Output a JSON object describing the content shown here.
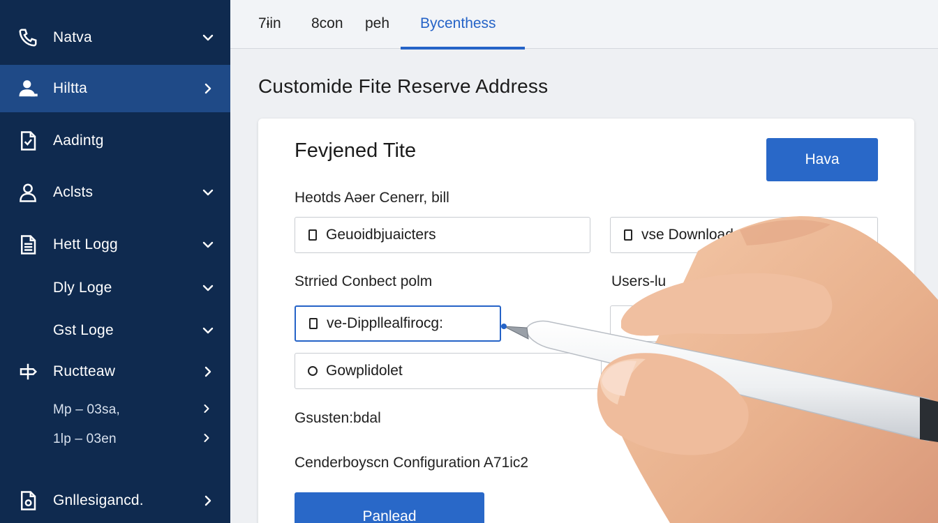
{
  "sidebar": {
    "items": [
      {
        "label": "Natva",
        "icon": "phone-icon",
        "chevron": "down"
      },
      {
        "label": "Hiltta",
        "icon": "user-icon",
        "chevron": "right",
        "active": true
      },
      {
        "label": "Aadintg",
        "icon": "document-check-icon",
        "chevron": "none"
      },
      {
        "label": "Aclsts",
        "icon": "person-icon",
        "chevron": "down"
      },
      {
        "label": "Hett Logg",
        "icon": "list-document-icon",
        "chevron": "down"
      },
      {
        "label": "Dly Loge",
        "icon": "",
        "chevron": "down"
      },
      {
        "label": "Gst Loge",
        "icon": "",
        "chevron": "down"
      },
      {
        "label": "Ructteaw",
        "icon": "signpost-icon",
        "chevron": "right"
      },
      {
        "label": "Mp – 03sa,",
        "icon": "",
        "chevron": "right"
      },
      {
        "label": "1lp – 03en",
        "icon": "",
        "chevron": "right"
      },
      {
        "label": "Gnllesigancd.",
        "icon": "settings-document-icon",
        "chevron": "right"
      }
    ]
  },
  "tabs": [
    {
      "label": "7ɨin"
    },
    {
      "label": "8con"
    },
    {
      "label": "peh"
    },
    {
      "label": "Bycenthess",
      "active": true
    }
  ],
  "page": {
    "title": "Customide Fite Reserve Address"
  },
  "card": {
    "title": "Fevjened Tite",
    "save_button": "Hava",
    "section1_label": "Heotds Aǝer Cenerr, bill",
    "field1_value": "Geuoidbjuaicters",
    "field2_value": "vse Downloads",
    "section2_label": "Strried Conbect polm",
    "section2_right_label": "Users-lu",
    "field3_value": "ve-Dippllealfirocg:",
    "field4_value": "Gowplidolet",
    "section3_label": "Gsusten:bdal",
    "section4_label": "Cenderboyscn Configuration A71ic2",
    "bottom_button": "Panlead"
  },
  "colors": {
    "sidebar_bg": "#0f2a4f",
    "sidebar_active": "#1f4a87",
    "accent": "#2968c8"
  }
}
